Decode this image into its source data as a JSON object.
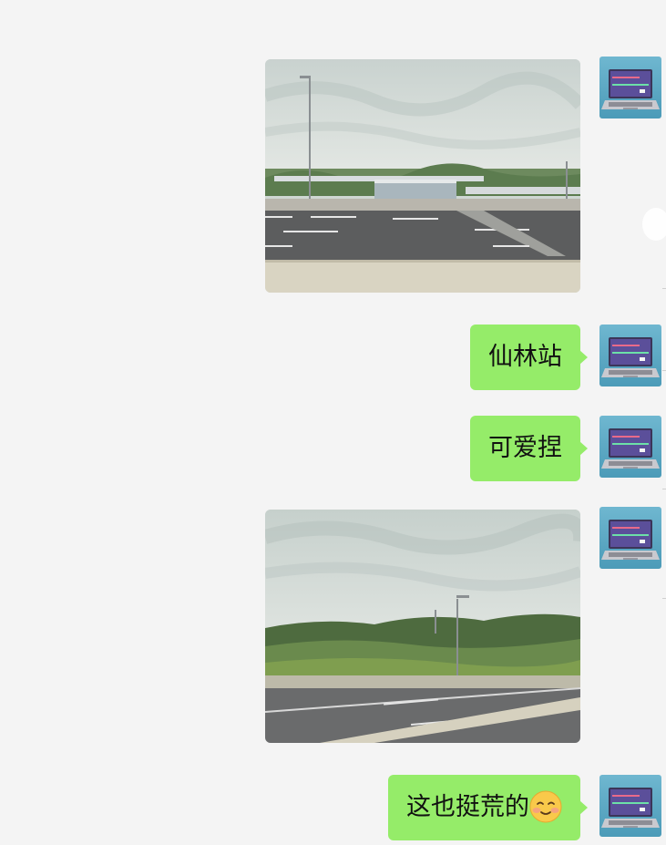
{
  "chat": {
    "messages": [
      {
        "type": "image",
        "sender": "self",
        "description_icon": "photo-station"
      },
      {
        "type": "text",
        "sender": "self",
        "text": "仙林站"
      },
      {
        "type": "text",
        "sender": "self",
        "text": "可爱捏"
      },
      {
        "type": "image",
        "sender": "self",
        "description_icon": "photo-hills"
      },
      {
        "type": "text",
        "sender": "self",
        "text": "这也挺荒的",
        "emoji": "smiling-face-icon"
      }
    ]
  },
  "colors": {
    "background": "#f4f4f4",
    "bubble_self": "#95ec69",
    "text": "#111111"
  }
}
